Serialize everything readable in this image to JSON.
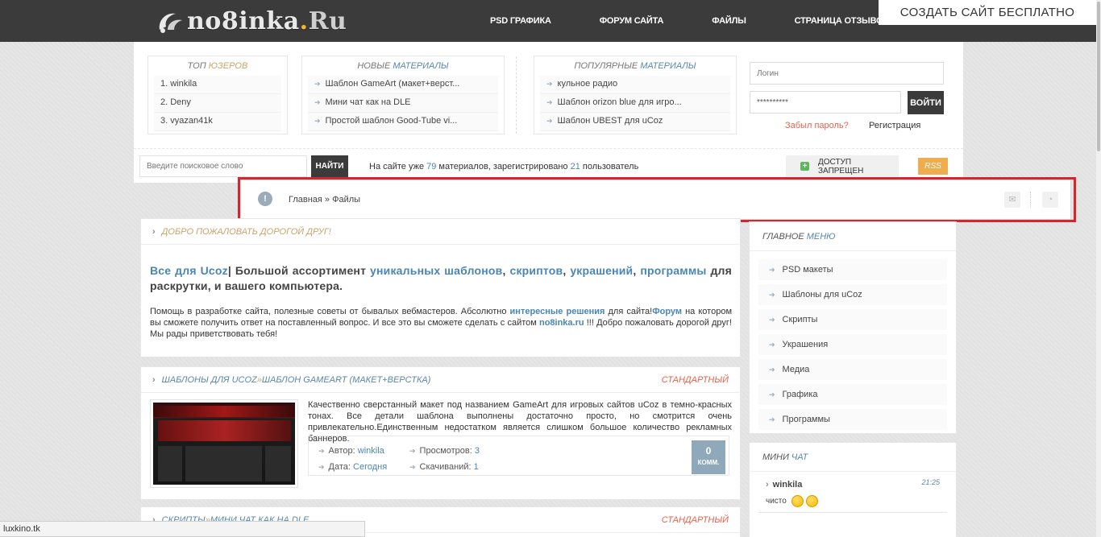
{
  "brand": {
    "logo_main": "no8inka",
    "logo_dot": ".",
    "logo_tld": "Ru",
    "accent": "#f2b632"
  },
  "topnav": [
    "PSD ГРАФИКА",
    "ФОРУМ САЙТА",
    "ФАЙЛЫ",
    "СТРАНИЦА ОТЗЫВОВ"
  ],
  "create_site": "СОЗДАТЬ САЙТ БЕСПЛАТНО",
  "top_users": {
    "title_a": "ТОП ",
    "title_b": "ЮЗЕРОВ",
    "items": [
      "1. winkila",
      "2. Deny",
      "3. vyazan41k"
    ]
  },
  "new_materials": {
    "title_a": "НОВЫЕ ",
    "title_b": "МАТЕРИАЛЫ",
    "items": [
      "Шаблон GameArt (макет+верст...",
      "Мини чат как на DLE",
      "Простой шаблон Good-Tube vi..."
    ]
  },
  "popular_materials": {
    "title_a": "ПОПУЛЯРНЫЕ ",
    "title_b": "МАТЕРИАЛЫ",
    "items": [
      "кульное радио",
      "Шаблон orizon blue для игро...",
      "Шаблон UBEST для uCoz"
    ]
  },
  "login": {
    "login_placeholder": "Логин",
    "password_value": "**********",
    "submit": "ВОЙТИ",
    "forgot": "Забыл пароль?",
    "register": "Регистрация"
  },
  "search": {
    "placeholder": "Введите поисковое слово",
    "button": "НАЙТИ"
  },
  "stats": {
    "prefix": "На сайте уже ",
    "materials": "79",
    "mid": " материалов, зарегистрировано ",
    "users": "21",
    "suffix": " пользователь"
  },
  "access": {
    "icon": "+",
    "label": "ДОСТУП ЗАПРЕЩЕН"
  },
  "rss": "RSS",
  "breadcrumb": {
    "icon": "!",
    "text": "Главная » Файлы",
    "mail_icon": "✉",
    "rss_icon": "◔"
  },
  "welcome": {
    "head": "ДОБРО ПОЖАЛОВАТЬ ДОРОГОЙ ДРУГ!",
    "t1": "Все для Ucoz",
    "t2": "| Большой ассортимент ",
    "t3": "уникальных шаблонов",
    "t4": ", ",
    "t5": "скриптов",
    "t6": ", ",
    "t7": "украшений",
    "t8": ", ",
    "t9": "программы",
    "t10": " для раскрутки, и вашего компьютера.",
    "p1": "Помощь в разработке сайта, полезные советы от бывалых вебмастеров. Абсолютно ",
    "p2": "интересные решения",
    "p3": " для сайта!",
    "p4": "Форум",
    "p5": " на котором вы сможете получить ответ на поставленный вопрос. И все это вы сможете сделать с сайтом ",
    "p6": "no8inka.ru",
    "p7": " !!! Добро пожаловать дорогой друг! Мы рады приветствовать тебя!"
  },
  "post1": {
    "cat": "ШАБЛОНЫ ДЛЯ UCOZ",
    "sep": " » ",
    "title": "ШАБЛОН GAMEART (МАКЕТ+ВЕРСТКА)",
    "tag": "СТАНДАРТНЫЙ",
    "desc": "Качественно сверстанный макет под названием GameArt для игровых сайтов uCoz в темно-красных тонах. Все детали шаблона выполнены достаточно просто, но смотрится очень привлекательно.Единственным недостатком является слишком большое количество рекламных баннеров.",
    "author_label": "Автор: ",
    "author": "winkila",
    "views_label": "Просмотров: ",
    "views": "3",
    "date_label": "Дата: ",
    "date": "Сегодня",
    "downloads_label": "Скачиваний: ",
    "downloads": "1",
    "comments": "0",
    "comments_label": "КОММ."
  },
  "post2": {
    "cat": "СКРИПТЫ",
    "sep": " » ",
    "title": "МИНИ ЧАТ КАК НА DLE",
    "tag": "СТАНДАРТНЫЙ"
  },
  "main_menu": {
    "title_a": "ГЛАВНОЕ ",
    "title_b": "МЕНЮ",
    "items": [
      "PSD макеты",
      "Шаблоны для uCoz",
      "Скрипты",
      "Украшения",
      "Медиа",
      "Графика",
      "Программы"
    ]
  },
  "mini_chat": {
    "title_a": "МИНИ ",
    "title_b": "ЧАТ",
    "user": "winkila",
    "time": "21:25",
    "msg": "чисто"
  },
  "statusbar": "luxkino.tk"
}
